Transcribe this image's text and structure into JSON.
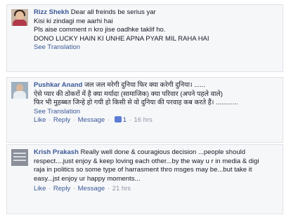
{
  "comments": [
    {
      "author": "Rizz Shekh",
      "lines": [
        "Dear all freinds be serius yar",
        "Kisi ki zindagi me aarhi hai",
        "Pls aise comment n kro jise oadhke taklif ho.",
        "DONO LUCKY HAIN KI UNHE APNA PYAR MIL RAHA HAI"
      ],
      "see_translation": "See Translation"
    },
    {
      "author": "Pushkar Anand",
      "lines": [
        "जल जल मरेगी दुनिया फिर क्या करेगी दुनिया। ......",
        "ऐसे प्यार की ठोकरों में है क्या मर्यादा (सामाजिक) क्या परिवार (अपने पहले वाले)",
        "फिर भी मुहब्बत जिन्हे हो गयी हो किसी से वो दुनिया की परवाह कब करते हैं। ............"
      ],
      "see_translation": "See Translation",
      "actions": {
        "like": "Like",
        "reply": "Reply",
        "message": "Message",
        "like_count": "1",
        "time": "16 hrs"
      }
    },
    {
      "author": "Krish Prakash",
      "lines": [
        "Really well done & couragious decision ...people should",
        "respect....just enjoy & keep loving each other...by the way u r in media & digi",
        "raja in politics so some type of harrasment thro msges may be...but take it",
        "easy...jst enjoy ur happy moments..."
      ],
      "actions": {
        "like": "Like",
        "reply": "Reply",
        "message": "Message",
        "time": "21 hrs"
      }
    }
  ]
}
